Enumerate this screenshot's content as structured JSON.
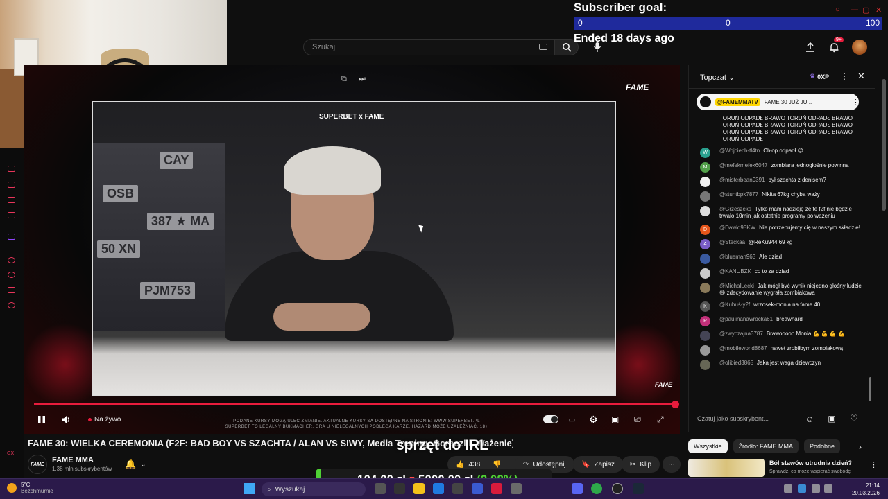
{
  "header": {
    "search_placeholder": "Szukaj",
    "notification_count": "9+"
  },
  "subscriber_goal": {
    "title": "Subscriber goal:",
    "min": "0",
    "current": "0",
    "max": "100",
    "status": "Ended 18 days ago"
  },
  "player": {
    "top_logo": "FAME",
    "inner_brand": "SUPERBET x FAME",
    "corner_logo": "FAME",
    "live_label": "Na żywo",
    "disclaimer_line1": "PODANE KURSY MOGĄ ULEC ZMIANIE. AKTUALNE KURSY SĄ DOSTĘPNE NA STRONIE: WWW.SUPERBET.PL",
    "disclaimer_line2": "SUPERBET TO LEGALNY BUKMACHER. GRA U NIELEGALNYCH PODLEGA KARZE. HAZARD MOŻE UZALEŻNIAĆ. 18+",
    "plates": [
      "CAY",
      "OSB",
      "387 ★ MA",
      "50 XN",
      "PJM753"
    ]
  },
  "video": {
    "title": "FAME 30: WIELKA CEREMONIA (F2F: BAD BOY VS SZACHTA / ALAN VS SIWY, Media Trening, Gorączki, Ważenie)",
    "channel_logo": "FAME",
    "channel_name": "FAME MMA",
    "subscribers": "1,38 mln subskrybentów",
    "likes": "438",
    "share_label": "Udostępnij",
    "save_label": "Zapisz",
    "clip_label": "Klip"
  },
  "stream_overlay": {
    "caption": "sprzęt do IRL",
    "donation_current": "104,00 zł",
    "donation_sep": "z",
    "donation_goal": "5000,00 zł",
    "donation_pct": "(2.08%)",
    "donation_fraction": 0.0208
  },
  "chat": {
    "title": "Topczat",
    "xp": "0XP",
    "pinned_user": "@FAMEMMATV",
    "pinned_text": "FAME 30 JUŻ JU...",
    "input_placeholder": "Czatuj jako subskrybent...",
    "messages": [
      {
        "user": "",
        "text": "TORUŃ ODPADŁ BRAWO TORUŃ ODPADŁ BRAWO TORUŃ ODPADŁ BRAWO TORUŃ ODPADŁ BRAWO TORUŃ ODPADŁ BRAWO TORUŃ ODPADŁ BRAWO TORUŃ ODPADŁ",
        "initial": "",
        "color": ""
      },
      {
        "user": "@Wojciech-tl4tn",
        "text": "Chłop odpadł 😔",
        "initial": "W",
        "color": "#2aa18f"
      },
      {
        "user": "@mefekmefek6047",
        "text": "zombiara jednogłośnie powinna",
        "initial": "M",
        "color": "#52a04a"
      },
      {
        "user": "@misterbean9391",
        "text": "był szachta z denisem?",
        "initial": "",
        "color": "#f1f1f1"
      },
      {
        "user": "@stuntbpk7877",
        "text": "Nikita 67kg chyba waży",
        "initial": "",
        "color": "#777"
      },
      {
        "user": "@Grzeszeks",
        "text": "Tylko mam nadzieję że te f2f nie będzie trwało 10min jak ostatnie programy po ważeniu",
        "initial": "",
        "color": "#ddd"
      },
      {
        "user": "@Dawid95KW",
        "text": "Nie potrzebujemy cię w naszym składzie!",
        "initial": "D",
        "color": "#e6551a"
      },
      {
        "user": "@Steckaa",
        "text": "@ReKu944 69 kg",
        "initial": "A",
        "color": "#7a5cc7"
      },
      {
        "user": "@blueman963",
        "text": "Ale dziad",
        "initial": "",
        "color": "#3a5aa0"
      },
      {
        "user": "@KANUBZK",
        "text": "co to za dziad",
        "initial": "",
        "color": "#ccc"
      },
      {
        "user": "@MichalLecki",
        "text": "Jak mógł być wynik niejedno głośny ludzie 😆 zdecydowanie wygrała zombiakowa",
        "initial": "",
        "color": "#8a7a5a"
      },
      {
        "user": "@Kubuś-y2f",
        "text": "wrzosek-monia na fame 40",
        "initial": "K",
        "color": "#555"
      },
      {
        "user": "@paulinanawrocka61",
        "text": "breawhard",
        "initial": "P",
        "color": "#c2307a"
      },
      {
        "user": "@zwyczajna3787",
        "text": "Brawooooo Monia 💪 💪 💪 💪",
        "initial": "",
        "color": "#445"
      },
      {
        "user": "@mobileworld8687",
        "text": "nawet zrobiłbym zombiakową",
        "initial": "",
        "color": "#999"
      },
      {
        "user": "@olibied3865",
        "text": "Jaka jest waga dziewczyn",
        "initial": "",
        "color": "#665"
      }
    ]
  },
  "related": {
    "chips": [
      "Wszystkie",
      "Źródło: FAME MMA",
      "Podobne"
    ],
    "first_title": "Ból stawów utrudnia dzień?",
    "first_subtitle": "Sprawdź, co może wspierać swobodę"
  },
  "taskbar": {
    "temperature": "5°C",
    "weather": "Bezchmurnie",
    "search_label": "Wyszukaj",
    "time": "21:14",
    "date": "20.03.2026"
  },
  "colors": {
    "accent_red": "#e81c3c",
    "goal_blue": "#1f2a9c",
    "donation_green": "#4fd135",
    "taskbar_purple": "#2b1a4a"
  },
  "icons": [
    "search-icon",
    "mic-icon",
    "upload-icon",
    "bell-icon",
    "pause-icon",
    "volume-icon",
    "settings-icon",
    "miniplayer-icon",
    "cast-icon",
    "fullscreen-icon",
    "like-icon",
    "dislike-icon",
    "share-icon",
    "save-icon",
    "clip-icon",
    "more-icon",
    "emoji-icon",
    "heart-icon",
    "close-icon",
    "chevron-down-icon",
    "chevron-right-icon"
  ]
}
